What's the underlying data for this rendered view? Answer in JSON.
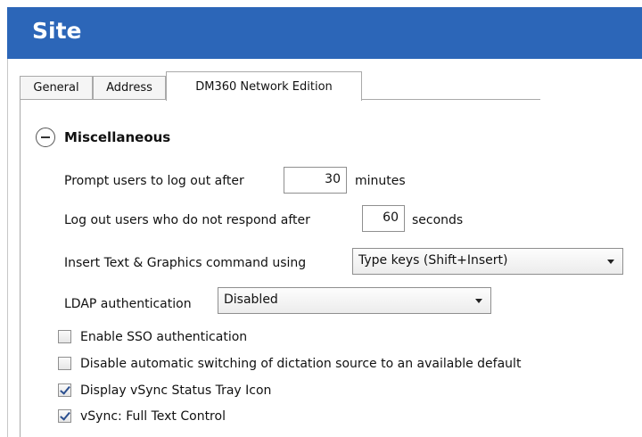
{
  "window": {
    "title": "Site"
  },
  "tabs": [
    {
      "label": "General",
      "active": false
    },
    {
      "label": "Address",
      "active": false
    },
    {
      "label": "DM360 Network Edition",
      "active": true
    }
  ],
  "section": {
    "title": "Miscellaneous",
    "expanded": true
  },
  "settings": {
    "logout_prompt": {
      "label": "Prompt users to log out after",
      "value": "30",
      "unit": "minutes"
    },
    "logout_no_response": {
      "label": "Log out users who do not respond after",
      "value": "60",
      "unit": "seconds"
    },
    "insert_command": {
      "label": "Insert Text & Graphics command using",
      "selected": "Type keys (Shift+Insert)"
    },
    "ldap": {
      "label": "LDAP authentication",
      "selected": "Disabled"
    }
  },
  "checkboxes": [
    {
      "label": "Enable SSO authentication",
      "checked": false
    },
    {
      "label": "Disable automatic switching of dictation source to an available default",
      "checked": false
    },
    {
      "label": "Display vSync Status Tray Icon",
      "checked": true
    },
    {
      "label": "vSync: Full Text Control",
      "checked": true
    }
  ],
  "colors": {
    "header_bg": "#2c66b8",
    "header_text": "#ffffff",
    "check_mark": "#2b4f8f"
  },
  "icons": {
    "collapse": "minus-circle-icon",
    "dropdown": "chevron-down-icon",
    "checkmark": "checkmark-icon"
  }
}
